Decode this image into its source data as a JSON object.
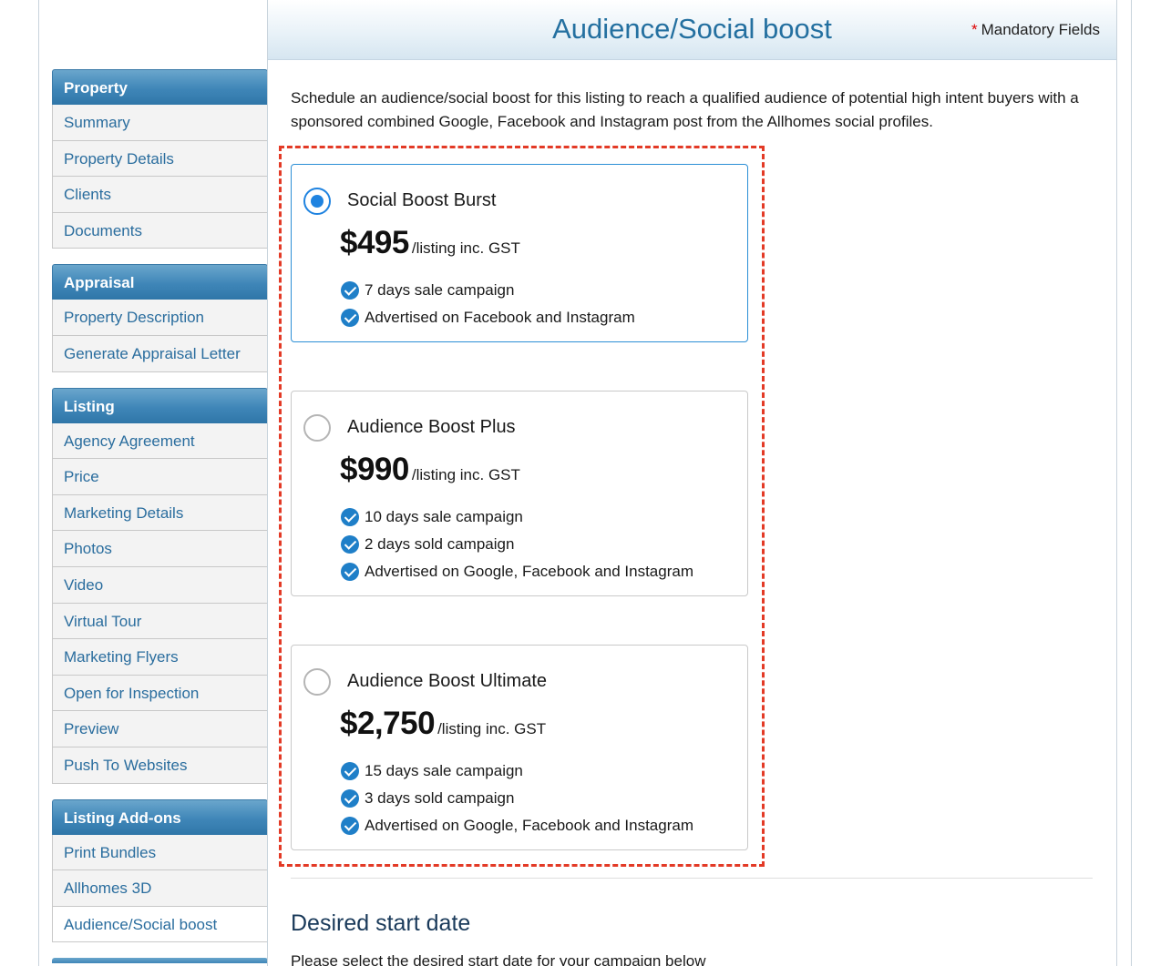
{
  "sidebar": {
    "groups": [
      {
        "title": "Property",
        "items": [
          "Summary",
          "Property Details",
          "Clients",
          "Documents"
        ]
      },
      {
        "title": "Appraisal",
        "items": [
          "Property Description",
          "Generate Appraisal Letter"
        ]
      },
      {
        "title": "Listing",
        "items": [
          "Agency Agreement",
          "Price",
          "Marketing Details",
          "Photos",
          "Video",
          "Virtual Tour",
          "Marketing Flyers",
          "Open for Inspection",
          "Preview",
          "Push To Websites"
        ]
      },
      {
        "title": "Listing Add-ons",
        "items": [
          "Print Bundles",
          "Allhomes 3D",
          "Audience/Social boost"
        ]
      }
    ],
    "active_item": "Audience/Social boost"
  },
  "header": {
    "title": "Audience/Social boost",
    "mandatory_star": "*",
    "mandatory_label": "Mandatory Fields"
  },
  "intro": "Schedule an audience/social boost for this listing to reach a qualified audience of potential high intent buyers with a sponsored combined Google, Facebook and Instagram post from the Allhomes social profiles.",
  "plans": [
    {
      "name": "Social Boost Burst",
      "price": "$495",
      "unit": "/listing inc. GST",
      "selected": true,
      "features": [
        "7 days sale campaign",
        "Advertised on Facebook and Instagram"
      ]
    },
    {
      "name": "Audience Boost Plus",
      "price": "$990",
      "unit": "/listing inc. GST",
      "selected": false,
      "features": [
        "10 days sale campaign",
        "2 days sold campaign",
        "Advertised on Google, Facebook and Instagram"
      ]
    },
    {
      "name": "Audience Boost Ultimate",
      "price": "$2,750",
      "unit": "/listing inc. GST",
      "selected": false,
      "features": [
        "15 days sale campaign",
        "3 days sold campaign",
        "Advertised on Google, Facebook and Instagram"
      ]
    }
  ],
  "start_date": {
    "title": "Desired start date",
    "subtitle": "Please select the desired start date for your campaign below"
  },
  "colors": {
    "sidebar_header": "#3f86b8",
    "link": "#2a6d9e",
    "title": "#2470a0",
    "radio_selected": "#1f83e0",
    "check": "#1f7fc8",
    "highlight_dash": "#e33a26"
  }
}
